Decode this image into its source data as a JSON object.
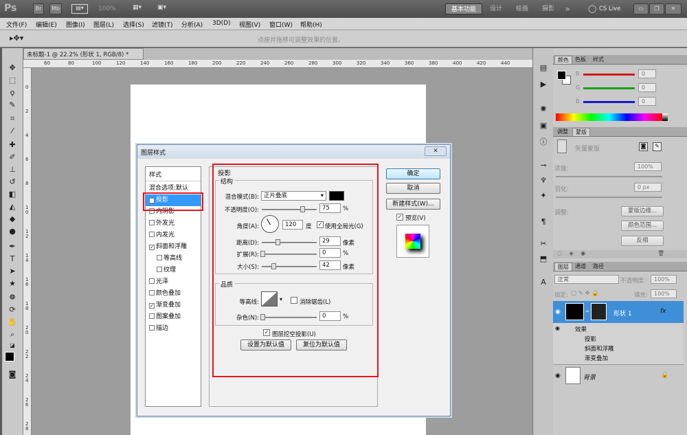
{
  "titlebar": {
    "app_logo": "Ps",
    "mode_items": [
      "Br",
      "Mb"
    ],
    "zoom": "100%",
    "workspaces": [
      "基本功能",
      "设计",
      "绘画",
      "摄影"
    ],
    "more": "»",
    "cs_live": "CS Live"
  },
  "menubar": {
    "items": [
      "文件(F)",
      "编辑(E)",
      "图像(I)",
      "图层(L)",
      "选择(S)",
      "滤镜(T)",
      "分析(A)",
      "3D(D)",
      "视图(V)",
      "窗口(W)",
      "帮助(H)"
    ]
  },
  "optionsbar": {
    "hint": "点按并拖移可调整效果的位置。"
  },
  "document": {
    "tab_title": "未标题-1 @ 22.2% (形状 1, RGB/8) *",
    "ruler_h": [
      "60",
      "80",
      "100",
      "120",
      "140",
      "160",
      "180",
      "200",
      "220",
      "240",
      "260",
      "280",
      "300",
      "320",
      "340",
      "360",
      "380",
      "400",
      "420",
      "440"
    ],
    "ruler_v": [
      "0",
      "2",
      "4",
      "6",
      "8",
      "1\n0",
      "1\n2",
      "1\n4",
      "1\n6",
      "1\n8",
      "2\n0",
      "2\n2",
      "2\n4",
      "2\n6",
      "2\n8"
    ]
  },
  "panels": {
    "color": {
      "tabs": [
        "颜色",
        "色板",
        "样式"
      ],
      "channels": [
        {
          "label": "R",
          "value": "0",
          "color": "#d01919"
        },
        {
          "label": "G",
          "value": "0",
          "color": "#19a019"
        },
        {
          "label": "B",
          "value": "0",
          "color": "#1919d0"
        }
      ]
    },
    "adjust": {
      "tabs": [
        "调整",
        "蒙版"
      ],
      "mask_label": "矢量蒙版",
      "density_label": "浓度:",
      "density_value": "100%",
      "feather_label": "羽化:",
      "feather_value": "0 px",
      "refine_label": "调整:",
      "buttons": [
        "蒙版边缘...",
        "颜色范围...",
        "反相"
      ]
    },
    "layers": {
      "tabs": [
        "图层",
        "通道",
        "路径"
      ],
      "blend_mode": "正常",
      "opacity_label": "不透明度:",
      "opacity_value": "100%",
      "lock_label": "锁定:",
      "fill_label": "填充:",
      "fill_value": "100%",
      "layer_name": "形状 1",
      "fx": "fx",
      "effects_label": "效果",
      "effects": [
        "投影",
        "斜面和浮雕",
        "渐变叠加"
      ],
      "background": "背景"
    }
  },
  "dialog": {
    "title": "图层样式",
    "close": "✕",
    "styles_header": "样式",
    "blend_default": "混合选项:默认",
    "styles": [
      {
        "label": "投影",
        "checked": true,
        "selected": true
      },
      {
        "label": "内阴影",
        "checked": false
      },
      {
        "label": "外发光",
        "checked": false
      },
      {
        "label": "内发光",
        "checked": false
      },
      {
        "label": "斜面和浮雕",
        "checked": true
      },
      {
        "label": "等高线",
        "checked": false,
        "indent": true
      },
      {
        "label": "纹理",
        "checked": false,
        "indent": true
      },
      {
        "label": "光泽",
        "checked": false
      },
      {
        "label": "颜色叠加",
        "checked": false
      },
      {
        "label": "渐变叠加",
        "checked": true
      },
      {
        "label": "图案叠加",
        "checked": false
      },
      {
        "label": "描边",
        "checked": false
      }
    ],
    "section_title": "投影",
    "structure": {
      "legend": "结构",
      "blend_mode_label": "混合模式(B):",
      "blend_mode_value": "正片叠底",
      "opacity_label": "不透明度(O):",
      "opacity_value": "75",
      "opacity_unit": "%",
      "opacity_level": 0.75,
      "angle_label": "角度(A):",
      "angle_value": "120",
      "angle_unit": "度",
      "global_light_label": "使用全局光(G)",
      "distance_label": "距离(D):",
      "distance_value": "29",
      "distance_unit": "像素",
      "spread_label": "扩展(R):",
      "spread_value": "0",
      "spread_unit": "%",
      "size_label": "大小(S):",
      "size_value": "42",
      "size_unit": "像素"
    },
    "quality": {
      "legend": "品质",
      "contour_label": "等高线:",
      "antialias_label": "消除锯齿(L)",
      "noise_label": "杂色(N):",
      "noise_value": "0",
      "noise_unit": "%"
    },
    "knockout_label": "图层挖空投影(U)",
    "make_default": "设置为默认值",
    "reset_default": "复位为默认值",
    "ok": "确定",
    "cancel": "取消",
    "new_style": "新建样式(W)...",
    "preview_label": "预览(V)"
  }
}
